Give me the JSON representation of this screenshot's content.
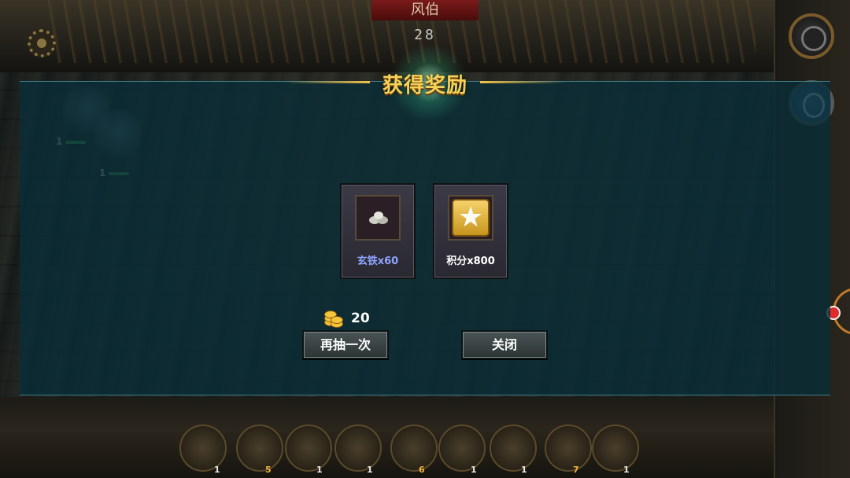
{
  "header": {
    "opponent_name": "风伯",
    "timer": "28"
  },
  "reward_dialog": {
    "title": "获得奖励",
    "items": [
      {
        "label": "玄铁x60",
        "icon": "iron-ore-icon",
        "label_color": "#8fa4ff"
      },
      {
        "label": "积分x800",
        "icon": "star-points-icon",
        "label_color": "#ffffff"
      }
    ],
    "cost": {
      "icon": "gold-coins-icon",
      "value": "20"
    },
    "buttons": {
      "draw_again": "再抽一次",
      "close": "关闭"
    }
  },
  "battlefield": {
    "units": [
      {
        "count": "1"
      },
      {
        "count": "1"
      }
    ]
  },
  "bottom_bar": {
    "slots": [
      {
        "count": "1"
      },
      {
        "count": "5"
      },
      {
        "count": "1"
      },
      {
        "count": "1"
      },
      {
        "count": "6"
      },
      {
        "count": "1"
      },
      {
        "count": "1"
      },
      {
        "count": "7"
      },
      {
        "count": "1"
      }
    ]
  },
  "colors": {
    "title": "#f5d257",
    "overlay": "#0a2d37",
    "accent_line": "#f2c24a"
  }
}
